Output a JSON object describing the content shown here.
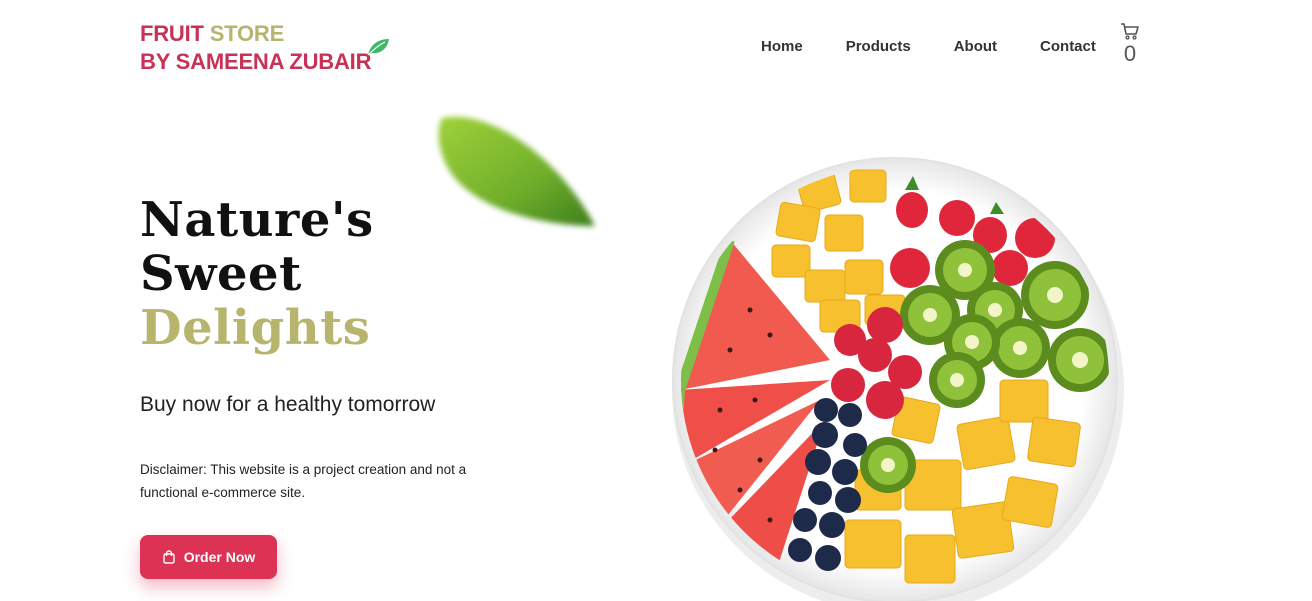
{
  "header": {
    "logo_line1_a": "FRUIT",
    "logo_line1_b": "STORE",
    "logo_line2": "BY SAMEENA ZUBAIR",
    "logo_icon": "leaf-icon",
    "nav": [
      {
        "label": "Home"
      },
      {
        "label": "Products"
      },
      {
        "label": "About"
      },
      {
        "label": "Contact"
      }
    ],
    "cart_icon": "cart-icon",
    "cart_count": "0"
  },
  "hero": {
    "title_line1": "Nature's",
    "title_line2": "Sweet",
    "title_line3": "Delights",
    "tagline": "Buy now for a healthy tomorrow",
    "disclaimer": "Disclaimer: This website is a project creation and not a functional e-commerce site.",
    "order_button": "Order Now",
    "order_icon": "shopping-bag-icon"
  },
  "colors": {
    "brand_red": "#dc3355",
    "olive": "#b7b46e",
    "leaf_green": "#3fb86a"
  }
}
